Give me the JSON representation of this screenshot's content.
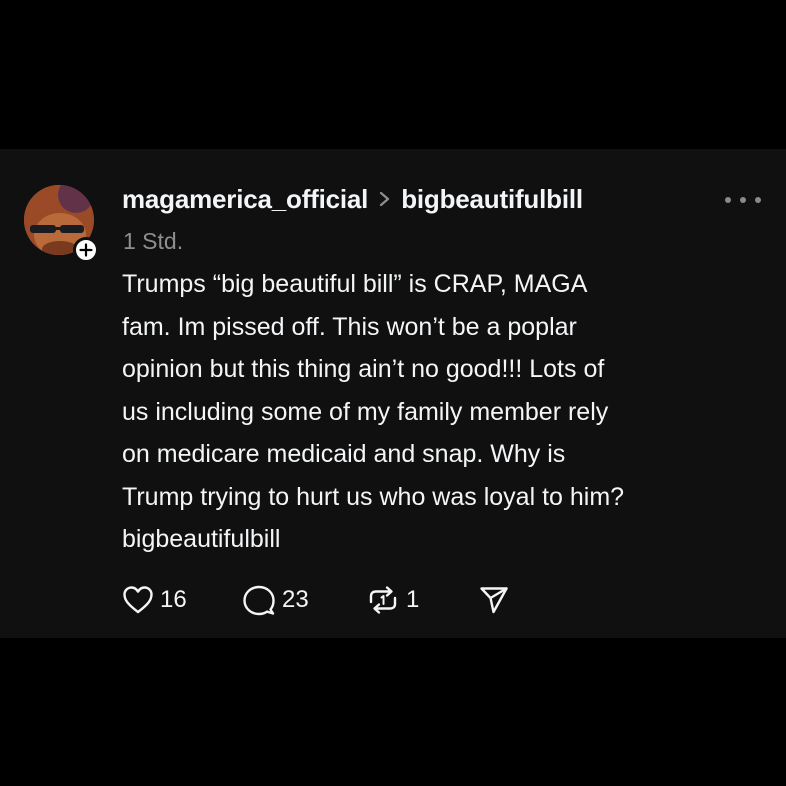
{
  "post": {
    "username": "magamerica_official",
    "topic": "bigbeautifulbill",
    "timestamp": "1 Std.",
    "body": "Trumps “big beautiful bill” is CRAP, MAGA\nfam. Im pissed off. This won’t be a poplar\nopinion but this thing ain’t no good!!! Lots of\nus including some of my family member rely\non medicare medicaid and snap. Why is\nTrump trying to hurt us who was loyal to him?\nbigbeautifulbill",
    "actions": {
      "like_count": "16",
      "reply_count": "23",
      "repost_count": "1"
    }
  },
  "icons": {
    "avatar_follow": "plus-icon",
    "breadcrumb": "chevron-right-icon",
    "more": "more-horizontal-icon",
    "like": "heart-icon",
    "reply": "comment-bubble-icon",
    "repost": "repost-icon",
    "share": "send-icon"
  },
  "colors": {
    "background": "#000000",
    "card": "#101010",
    "text": "#f3f5f7",
    "muted": "#8e8e8e"
  }
}
